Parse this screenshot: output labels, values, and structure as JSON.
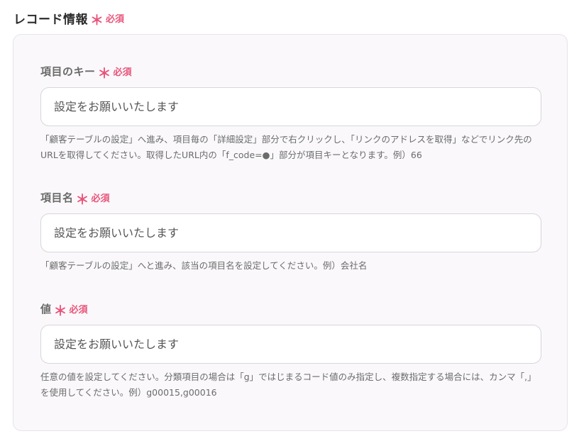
{
  "section": {
    "title": "レコード情報",
    "required_mark": "＊",
    "required_text": "必須"
  },
  "fields": [
    {
      "label": "項目のキー",
      "required_mark": "＊",
      "required_text": "必須",
      "placeholder": "設定をお願いいたします",
      "value": "",
      "help": "「顧客テーブルの設定」へ進み、項目毎の「詳細設定」部分で右クリックし、「リンクのアドレスを取得」などでリンク先のURLを取得してください。取得したURL内の「f_code=●」部分が項目キーとなります。例）66"
    },
    {
      "label": "項目名",
      "required_mark": "＊",
      "required_text": "必須",
      "placeholder": "設定をお願いいたします",
      "value": "",
      "help": "「顧客テーブルの設定」へと進み、該当の項目名を設定してください。例）会社名"
    },
    {
      "label": "値",
      "required_mark": "＊",
      "required_text": "必須",
      "placeholder": "設定をお願いいたします",
      "value": "",
      "help": "任意の値を設定してください。分類項目の場合は「g」ではじまるコード値のみ指定し、複数指定する場合には、カンマ「,」を使用してください。例）g00015,g00016"
    }
  ]
}
